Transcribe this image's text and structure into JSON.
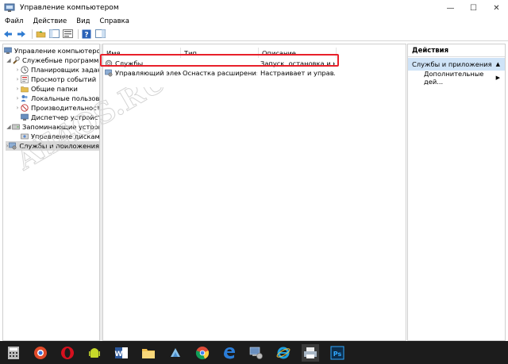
{
  "window": {
    "title": "Управление компьютером",
    "controls": {
      "minimize": "—",
      "maximize": "☐",
      "close": "✕"
    }
  },
  "menu": [
    "Файл",
    "Действие",
    "Вид",
    "Справка"
  ],
  "tree": {
    "root": "Управление компьютером (л",
    "items": [
      {
        "label": "Служебные программы"
      },
      {
        "label": "Планировщик заданий"
      },
      {
        "label": "Просмотр событий"
      },
      {
        "label": "Общие папки"
      },
      {
        "label": "Локальные пользоват"
      },
      {
        "label": "Производительность"
      },
      {
        "label": "Диспетчер устройств"
      },
      {
        "label": "Запоминающие устройсте"
      },
      {
        "label": "Управление дисками"
      },
      {
        "label": "Службы и приложения"
      }
    ]
  },
  "list": {
    "columns": [
      "Имя",
      "Тип",
      "Описание"
    ],
    "rows": [
      {
        "name": "Службы",
        "type": "",
        "description": "Запуск, остановка и на..."
      },
      {
        "name": "Управляющий элем...",
        "type": "Оснастка расширения",
        "description": "Настраивает и управля..."
      }
    ]
  },
  "actions": {
    "header": "Действия",
    "section": "Службы и приложения",
    "more": "Дополнительные дей..."
  },
  "watermark": "All4OS.RU",
  "taskbar_icons": [
    "calculator-icon",
    "chrome-canary-icon",
    "opera-icon",
    "android-icon",
    "word-icon",
    "file-explorer-icon",
    "app-icon",
    "chrome-icon",
    "edge-icon",
    "computer-management-icon",
    "ie-icon",
    "printer-icon",
    "photoshop-icon"
  ]
}
